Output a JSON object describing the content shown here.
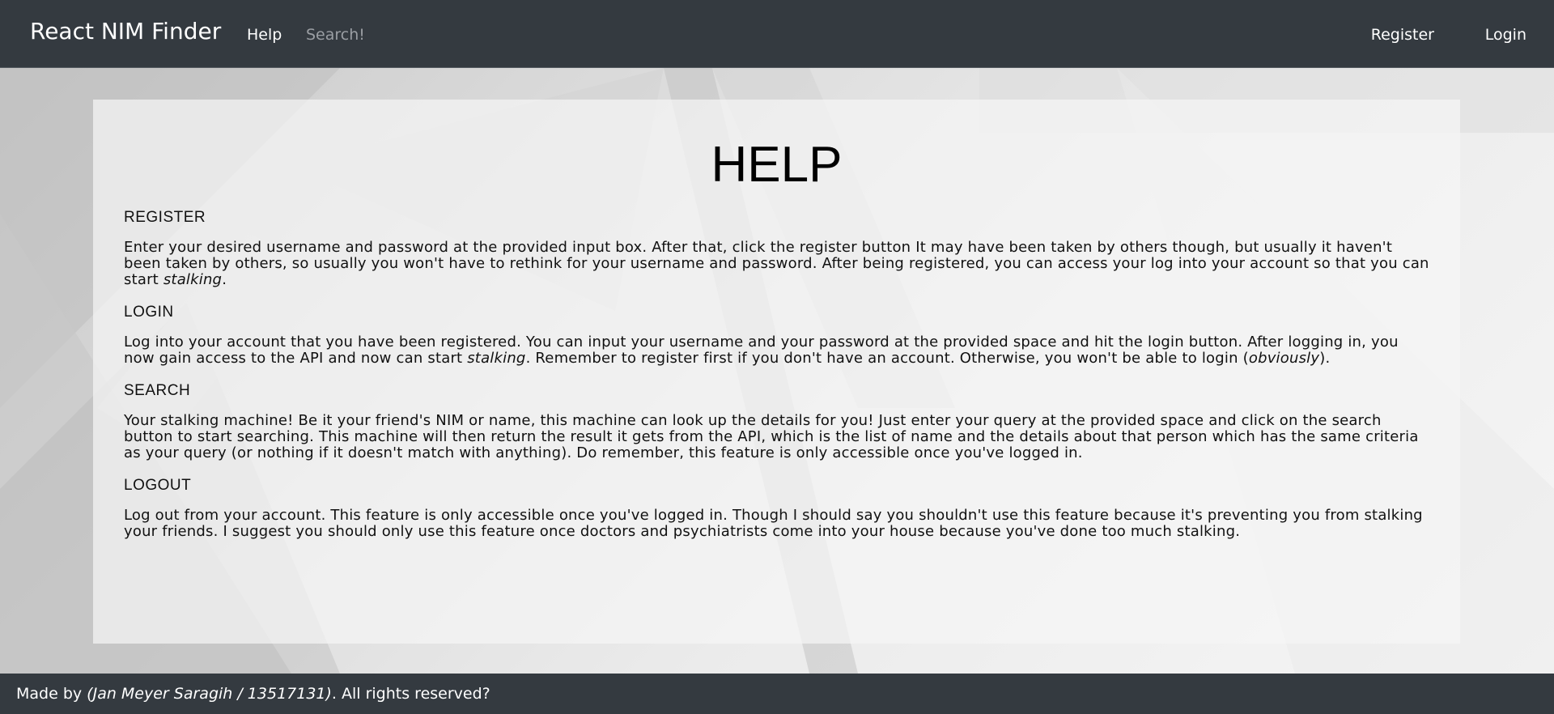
{
  "navbar": {
    "brand": "React NIM Finder",
    "help": "Help",
    "search": "Search!",
    "register": "Register",
    "login": "Login"
  },
  "page": {
    "title": "HELP",
    "sections": [
      {
        "title": "REGISTER",
        "body_before": "Enter your desired username and password at the provided input box. After that, click the register button It may have been taken by others though, but usually it haven't been taken by others, so usually you won't have to rethink for your username and password. After being registered, you can access your log into your account so that you can start ",
        "body_em": "stalking",
        "body_after": "."
      },
      {
        "title": "LOGIN",
        "body_before": "Log into your account that you have been registered. You can input your username and your password at the provided space and hit the login button. After logging in, you now gain access to the API and now can start ",
        "body_em": "stalking",
        "body_middle": ". Remember to register first if you don't have an account. Otherwise, you won't be able to login (",
        "body_em2": "obviously",
        "body_after": ")."
      },
      {
        "title": "SEARCH",
        "body": "Your stalking machine! Be it your friend's NIM or name, this machine can look up the details for you! Just enter your query at the provided space and click on the search button to start searching. This machine will then return the result it gets from the API, which is the list of name and the details about that person which has the same criteria as your query (or nothing if it doesn't match with anything). Do remember, this feature is only accessible once you've logged in."
      },
      {
        "title": "LOGOUT",
        "body": "Log out from your account. This feature is only accessible once you've logged in. Though I should say you shouldn't use this feature because it's preventing you from stalking your friends. I suggest you should only use this feature once doctors and psychiatrists come into your house because you've done too much stalking."
      }
    ]
  },
  "footer": {
    "prefix": "Made by ",
    "author": "(Jan Meyer Saragih / 13517131)",
    "suffix": ". All rights reserved?"
  },
  "colors": {
    "navbar_bg": "#343a40",
    "nav_muted": "#9a9ea3",
    "card_bg": "#f5f5f5"
  }
}
